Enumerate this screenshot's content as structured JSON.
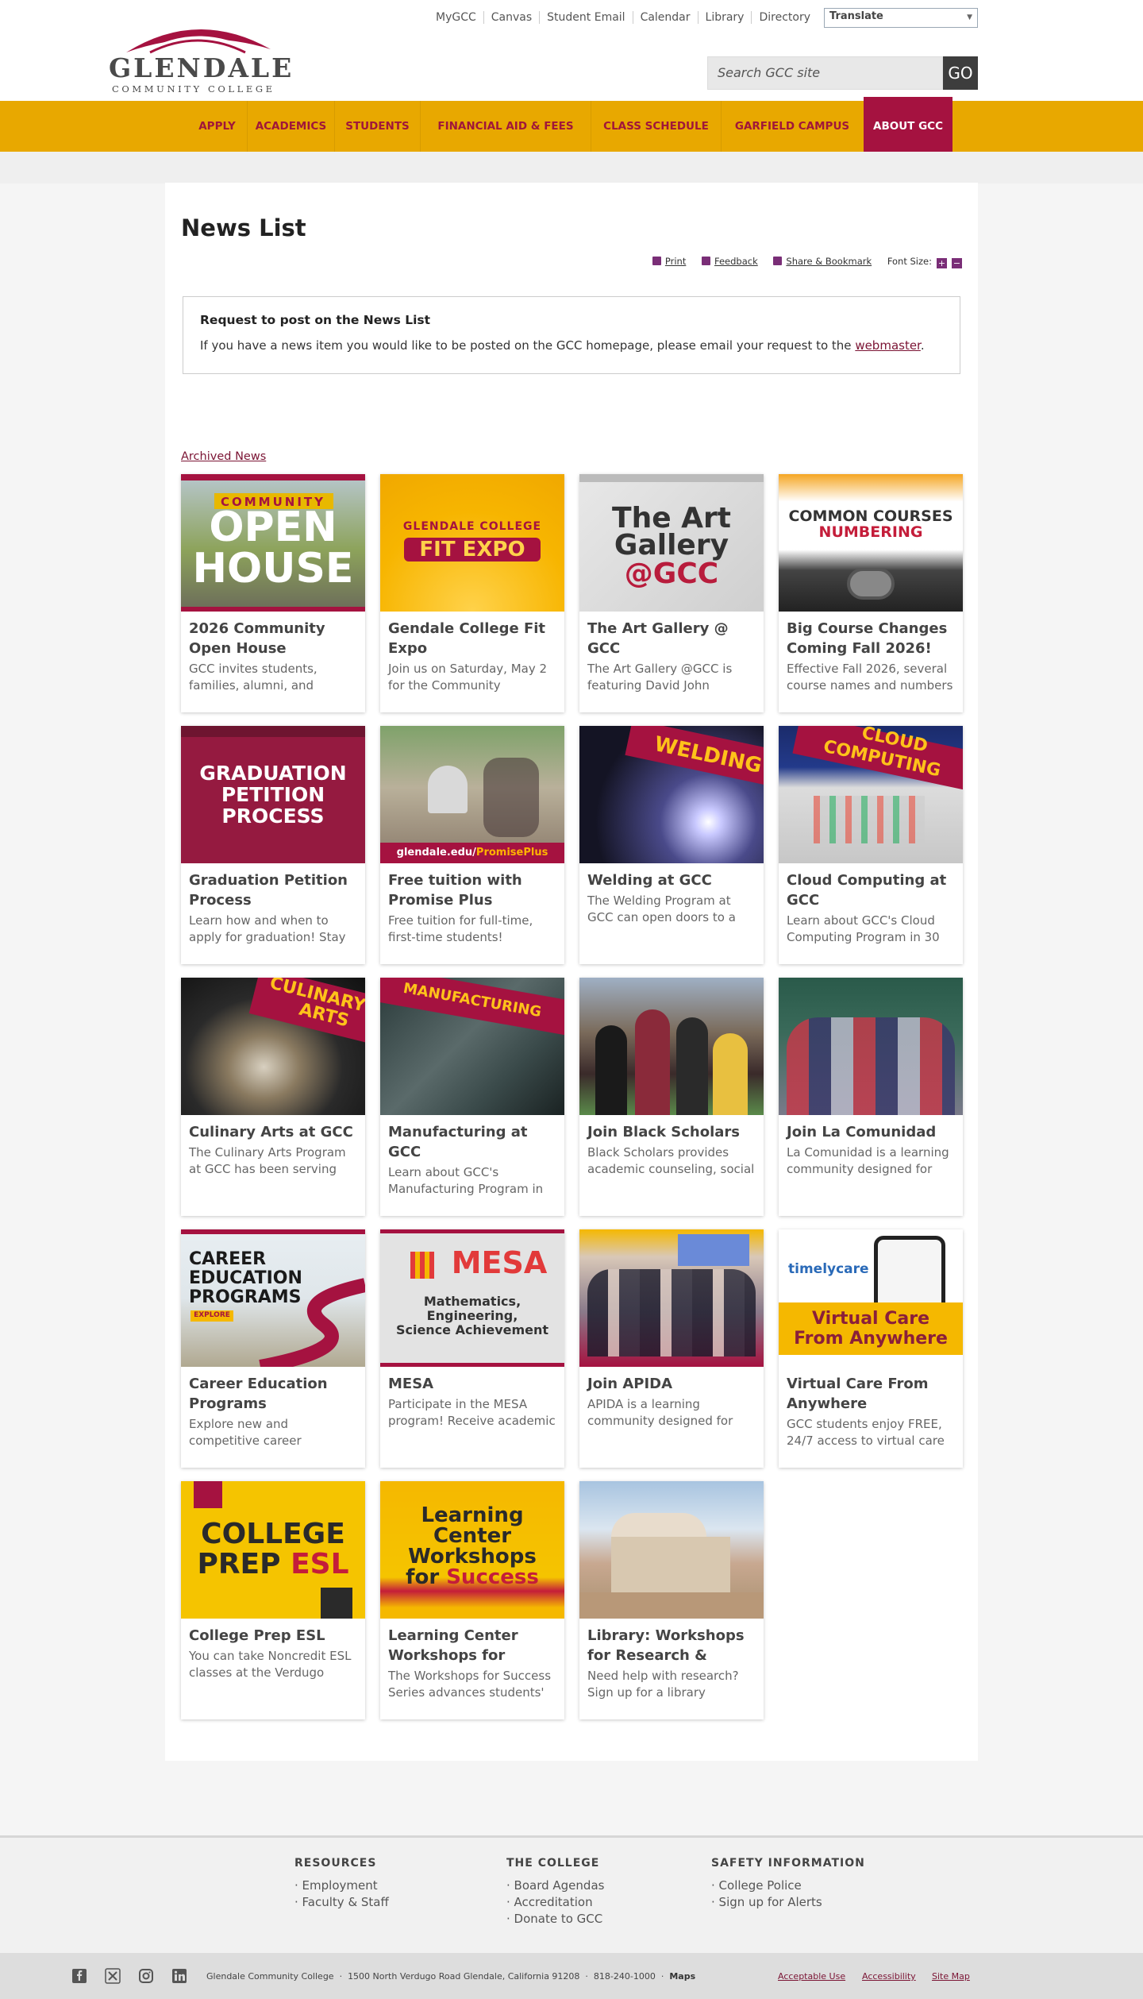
{
  "header": {
    "logo_name": "GLENDALE",
    "logo_sub": "COMMUNITY COLLEGE",
    "utility_links": [
      "MyGCC",
      "Canvas",
      "Student Email",
      "Calendar",
      "Library",
      "Directory"
    ],
    "translate_label": "Translate",
    "search_placeholder": "Search GCC site",
    "go_label": "GO"
  },
  "nav": {
    "items": [
      "APPLY",
      "ACADEMICS",
      "STUDENTS",
      "FINANCIAL AID & FEES",
      "CLASS SCHEDULE",
      "GARFIELD CAMPUS",
      "ABOUT GCC"
    ],
    "active": "ABOUT GCC"
  },
  "page": {
    "title": "News List",
    "tools": {
      "print": "Print",
      "feedback": "Feedback",
      "share": "Share & Bookmark",
      "font_size": "Font Size:"
    },
    "notice_title": "Request to post on the News List",
    "notice_text_before": "If you have a news item you would like to be posted on the GCC homepage, please email your request to the ",
    "notice_link": "webmaster",
    "notice_text_after": ".",
    "archived_link": "Archived News"
  },
  "cards": [
    {
      "title": "2026 Community Open House",
      "desc": "GCC invites students, families, alumni, and",
      "img_lines": [
        "COMMUNITY",
        "OPEN",
        "HOUSE"
      ]
    },
    {
      "title": "Gendale College Fit Expo",
      "desc": "Join us on Saturday, May 2 for the Community",
      "img_lines": [
        "GLENDALE COLLEGE",
        "FIT EXPO"
      ]
    },
    {
      "title": "The Art Gallery @ GCC",
      "desc": "The Art Gallery @GCC is featuring David John",
      "img_lines": [
        "The Art",
        "Gallery",
        "@GCC"
      ]
    },
    {
      "title": "Big Course Changes Coming Fall 2026!",
      "desc": "Effective Fall 2026, several course names and numbers",
      "img_lines": [
        "COMMON COURSES",
        "NUMBERING"
      ]
    },
    {
      "title": "Graduation Petition Process",
      "desc": "Learn how and when to apply for graduation! Stay",
      "img_lines": [
        "GRADUATION",
        "PETITION",
        "PROCESS"
      ]
    },
    {
      "title": "Free tuition with Promise Plus",
      "desc": "Free tuition for full-time, first-time students!",
      "img_lines": [
        "glendale.edu/",
        "PromisePlus"
      ]
    },
    {
      "title": "Welding at GCC",
      "desc": "The Welding Program at GCC can open doors to a",
      "img_lines": [
        "WELDING"
      ]
    },
    {
      "title": "Cloud Computing at GCC",
      "desc": "Learn about GCC's Cloud Computing Program in 30",
      "img_lines": [
        "CLOUD",
        "COMPUTING"
      ]
    },
    {
      "title": "Culinary Arts at GCC",
      "desc": "The Culinary Arts Program at GCC has been serving",
      "img_lines": [
        "CULINARY",
        "ARTS"
      ]
    },
    {
      "title": "Manufacturing at GCC",
      "desc": "Learn about GCC's Manufacturing Program in",
      "img_lines": [
        "MANUFACTURING"
      ]
    },
    {
      "title": "Join Black Scholars",
      "desc": "Black Scholars provides academic counseling, social",
      "img_lines": []
    },
    {
      "title": "Join La Comunidad",
      "desc": "La Comunidad is a learning community designed for",
      "img_lines": []
    },
    {
      "title": "Career Education Programs",
      "desc": "Explore new and competitive career",
      "img_lines": [
        "CAREER",
        "EDUCATION",
        "PROGRAMS",
        "EXPLORE"
      ]
    },
    {
      "title": "MESA",
      "desc": "Participate in the MESA program! Receive academic",
      "img_lines": [
        "MESA",
        "Mathematics,",
        "Engineering,",
        "Science Achievement"
      ]
    },
    {
      "title": "Join APIDA",
      "desc": "APIDA is a learning community designed for",
      "img_lines": []
    },
    {
      "title": "Virtual Care From Anywhere",
      "desc": "GCC students enjoy FREE, 24/7 access to virtual care",
      "img_lines": [
        "timelycare",
        "Virtual Care",
        "From Anywhere"
      ]
    },
    {
      "title": "College Prep ESL",
      "desc": "You can take Noncredit ESL classes at the Verdugo",
      "img_lines": [
        "COLLEGE",
        "PREP",
        "ESL"
      ]
    },
    {
      "title": "Learning Center Workshops for",
      "desc": "The Workshops for Success Series advances students'",
      "img_lines": [
        "Learning",
        "Center",
        "Workshops",
        "for",
        "Success"
      ]
    },
    {
      "title": "Library: Workshops for Research &",
      "desc": "Need help with research? Sign up for a library",
      "img_lines": []
    }
  ],
  "footer": {
    "columns": [
      {
        "heading": "RESOURCES",
        "links": [
          "Employment",
          "Faculty & Staff"
        ]
      },
      {
        "heading": "THE COLLEGE",
        "links": [
          "Board Agendas",
          "Accreditation",
          "Donate to GCC"
        ]
      },
      {
        "heading": "SAFETY INFORMATION",
        "links": [
          "College Police",
          "Sign up for Alerts"
        ]
      }
    ],
    "college_name": "Glendale Community College",
    "address": "1500 North Verdugo Road Glendale, California 91208",
    "phone": "818-240-1000",
    "maps": "Maps",
    "legal_links": [
      "Acceptable Use",
      "Accessibility",
      "Site Map"
    ],
    "social_icons": [
      "facebook-icon",
      "x-icon",
      "instagram-icon",
      "linkedin-icon"
    ]
  },
  "colors": {
    "nav_bg": "#e8a800",
    "brand_red": "#a51240",
    "link": "#7b1434"
  }
}
